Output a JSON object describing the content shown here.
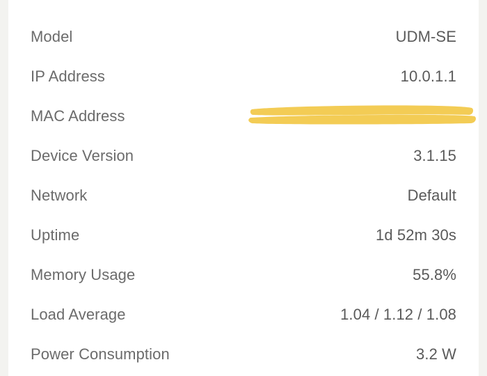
{
  "details": {
    "model": {
      "label": "Model",
      "value": "UDM-SE"
    },
    "ip_address": {
      "label": "IP Address",
      "value": "10.0.1.1"
    },
    "mac_address": {
      "label": "MAC Address",
      "value": ""
    },
    "device_version": {
      "label": "Device Version",
      "value": "3.1.15"
    },
    "network": {
      "label": "Network",
      "value": "Default"
    },
    "uptime": {
      "label": "Uptime",
      "value": "1d 52m 30s"
    },
    "memory_usage": {
      "label": "Memory Usage",
      "value": "55.8%"
    },
    "load_average": {
      "label": "Load Average",
      "value": "1.04 / 1.12 / 1.08"
    },
    "power_consumption": {
      "label": "Power Consumption",
      "value": "3.2 W"
    }
  },
  "redaction_color": "#f2c94c"
}
